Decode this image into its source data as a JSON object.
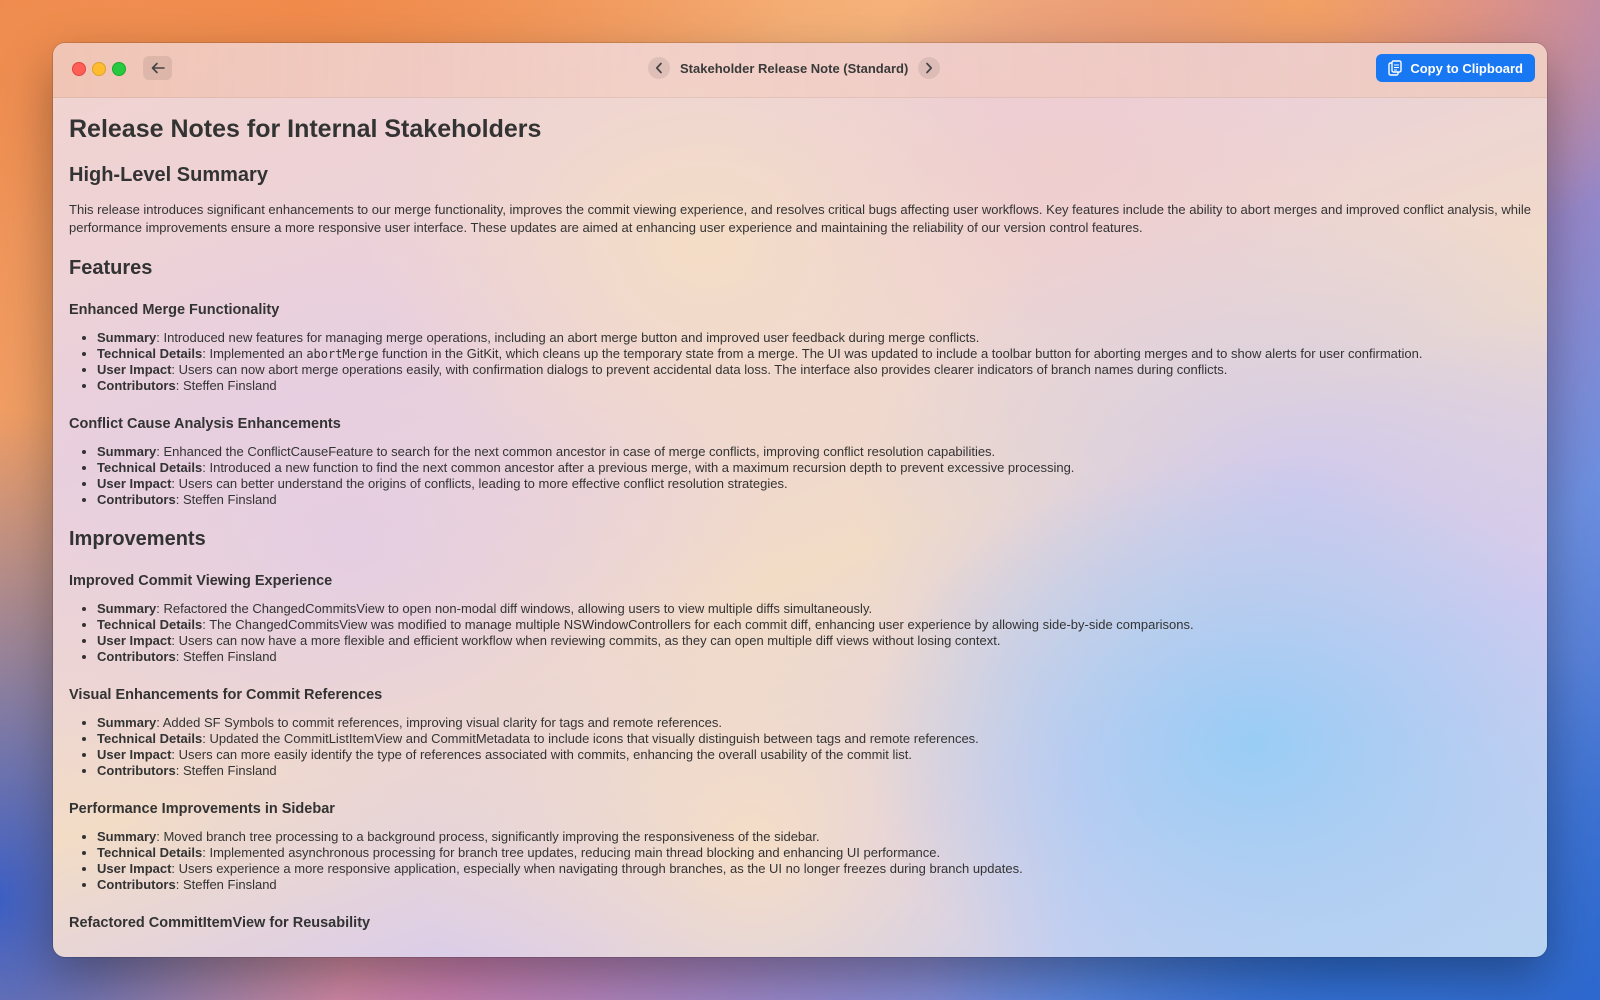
{
  "window": {
    "nav_title": "Stakeholder Release Note (Standard)",
    "copy_label": "Copy to Clipboard",
    "accent": "#1877f2"
  },
  "doc": {
    "title": "Release Notes for Internal Stakeholders",
    "summary_heading": "High-Level Summary",
    "summary": "This release introduces significant enhancements to our merge functionality, improves the commit viewing experience, and resolves critical bugs affecting user workflows. Key features include the ability to abort merges and improved conflict analysis, while performance improvements ensure a more responsive user interface. These updates are aimed at enhancing user experience and maintaining the reliability of our version control features.",
    "labels": {
      "summary": "Summary",
      "technical": "Technical Details",
      "impact": "User Impact",
      "contributors": "Contributors"
    },
    "features_heading": "Features",
    "features": [
      {
        "title": "Enhanced Merge Functionality",
        "summary": ": Introduced new features for managing merge operations, including an abort merge button and improved user feedback during merge conflicts.",
        "technical_pre": ": Implemented an ",
        "technical_code": "abortMerge",
        "technical_post": " function in the GitKit, which cleans up the temporary state from a merge. The UI was updated to include a toolbar button for aborting merges and to show alerts for user confirmation.",
        "impact": ": Users can now abort merge operations easily, with confirmation dialogs to prevent accidental data loss. The interface also provides clearer indicators of branch names during conflicts.",
        "contributors": ": Steffen Finsland"
      },
      {
        "title": "Conflict Cause Analysis Enhancements",
        "summary": ": Enhanced the ConflictCauseFeature to search for the next common ancestor in case of merge conflicts, improving conflict resolution capabilities.",
        "technical": ": Introduced a new function to find the next common ancestor after a previous merge, with a maximum recursion depth to prevent excessive processing.",
        "impact": ": Users can better understand the origins of conflicts, leading to more effective conflict resolution strategies.",
        "contributors": ": Steffen Finsland"
      }
    ],
    "improvements_heading": "Improvements",
    "improvements": [
      {
        "title": "Improved Commit Viewing Experience",
        "summary": ": Refactored the ChangedCommitsView to open non-modal diff windows, allowing users to view multiple diffs simultaneously.",
        "technical": ": The ChangedCommitsView was modified to manage multiple NSWindowControllers for each commit diff, enhancing user experience by allowing side-by-side comparisons.",
        "impact": ": Users can now have a more flexible and efficient workflow when reviewing commits, as they can open multiple diff views without losing context.",
        "contributors": ": Steffen Finsland"
      },
      {
        "title": "Visual Enhancements for Commit References",
        "summary": ": Added SF Symbols to commit references, improving visual clarity for tags and remote references.",
        "technical": ": Updated the CommitListItemView and CommitMetadata to include icons that visually distinguish between tags and remote references.",
        "impact": ": Users can more easily identify the type of references associated with commits, enhancing the overall usability of the commit list.",
        "contributors": ": Steffen Finsland"
      },
      {
        "title": "Performance Improvements in Sidebar",
        "summary": ": Moved branch tree processing to a background process, significantly improving the responsiveness of the sidebar.",
        "technical": ": Implemented asynchronous processing for branch tree updates, reducing main thread blocking and enhancing UI performance.",
        "impact": ": Users experience a more responsive application, especially when navigating through branches, as the UI no longer freezes during branch updates.",
        "contributors": ": Steffen Finsland"
      },
      {
        "title": "Refactored CommitItemView for Reusability"
      }
    ]
  }
}
